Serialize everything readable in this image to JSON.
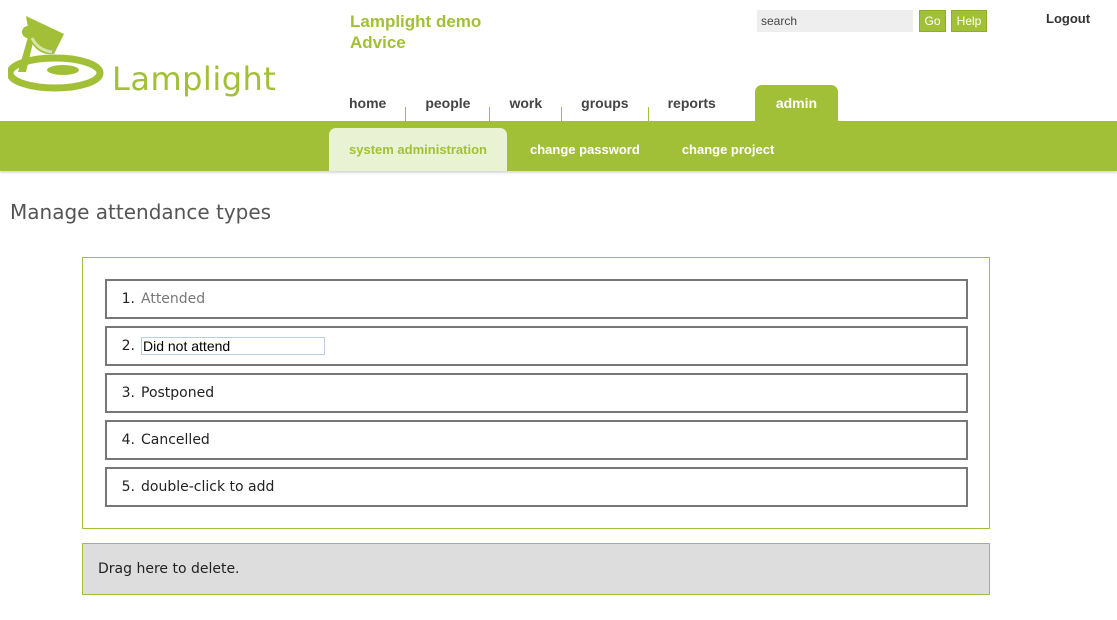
{
  "header": {
    "logo_text": "Lamplight",
    "project_title_line1": "Lamplight demo",
    "project_title_line2": "Advice",
    "search_placeholder": "search",
    "go_label": "Go",
    "help_label": "Help",
    "logout_label": "Logout"
  },
  "main_nav": {
    "items": [
      {
        "label": "home"
      },
      {
        "label": "people"
      },
      {
        "label": "work"
      },
      {
        "label": "groups"
      },
      {
        "label": "reports"
      },
      {
        "label": "admin",
        "active": true
      }
    ]
  },
  "sub_nav": {
    "items": [
      {
        "label": "system administration",
        "active": true
      },
      {
        "label": "change password"
      },
      {
        "label": "change project"
      }
    ]
  },
  "page": {
    "title": "Manage attendance types",
    "items": [
      {
        "num": "1.",
        "label": "Attended"
      },
      {
        "num": "2.",
        "value": "Did not attend"
      },
      {
        "num": "3.",
        "label": "Postponed"
      },
      {
        "num": "4.",
        "label": "Cancelled"
      },
      {
        "num": "5.",
        "label": "double-click to add"
      }
    ],
    "delete_zone": "Drag here to delete."
  },
  "colors": {
    "accent": "#a2c037",
    "accent_light": "#eaf2d4",
    "delete_zone_bg": "#dddddd"
  }
}
